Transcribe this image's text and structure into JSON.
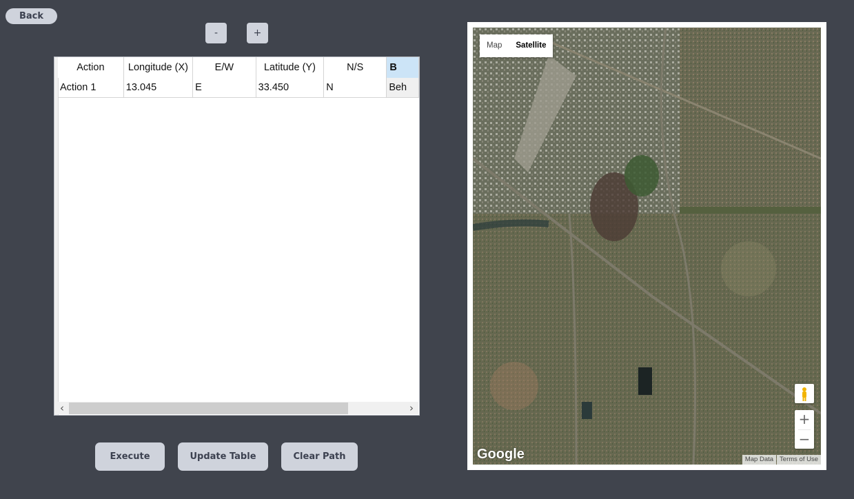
{
  "nav": {
    "back_label": "Back"
  },
  "columns_controls": {
    "minus_label": "-",
    "plus_label": "+"
  },
  "table": {
    "headers": [
      "Action",
      "Longitude (X)",
      "E/W",
      "Latitude (Y)",
      "N/S",
      "B"
    ],
    "rows": [
      {
        "action": "Action 1",
        "longitude": "13.045",
        "ew": "E",
        "latitude": "33.450",
        "ns": "N",
        "extra": "Beh"
      }
    ]
  },
  "buttons": {
    "execute": "Execute",
    "update_table": "Update Table",
    "clear_path": "Clear Path"
  },
  "map": {
    "type_options": [
      "Map",
      "Satellite"
    ],
    "active_type": "Satellite",
    "logo": "Google",
    "zoom_in": "+",
    "zoom_out": "−",
    "attribution": [
      "Map Data",
      "Terms of Use"
    ]
  },
  "colors": {
    "background": "#40444d",
    "button_bg": "#cfd3dc",
    "header_selected": "#cce4f7"
  },
  "icons": {
    "pegman": "pegman-icon",
    "scroll_left": "chevron-left-icon",
    "scroll_right": "chevron-right-icon"
  }
}
